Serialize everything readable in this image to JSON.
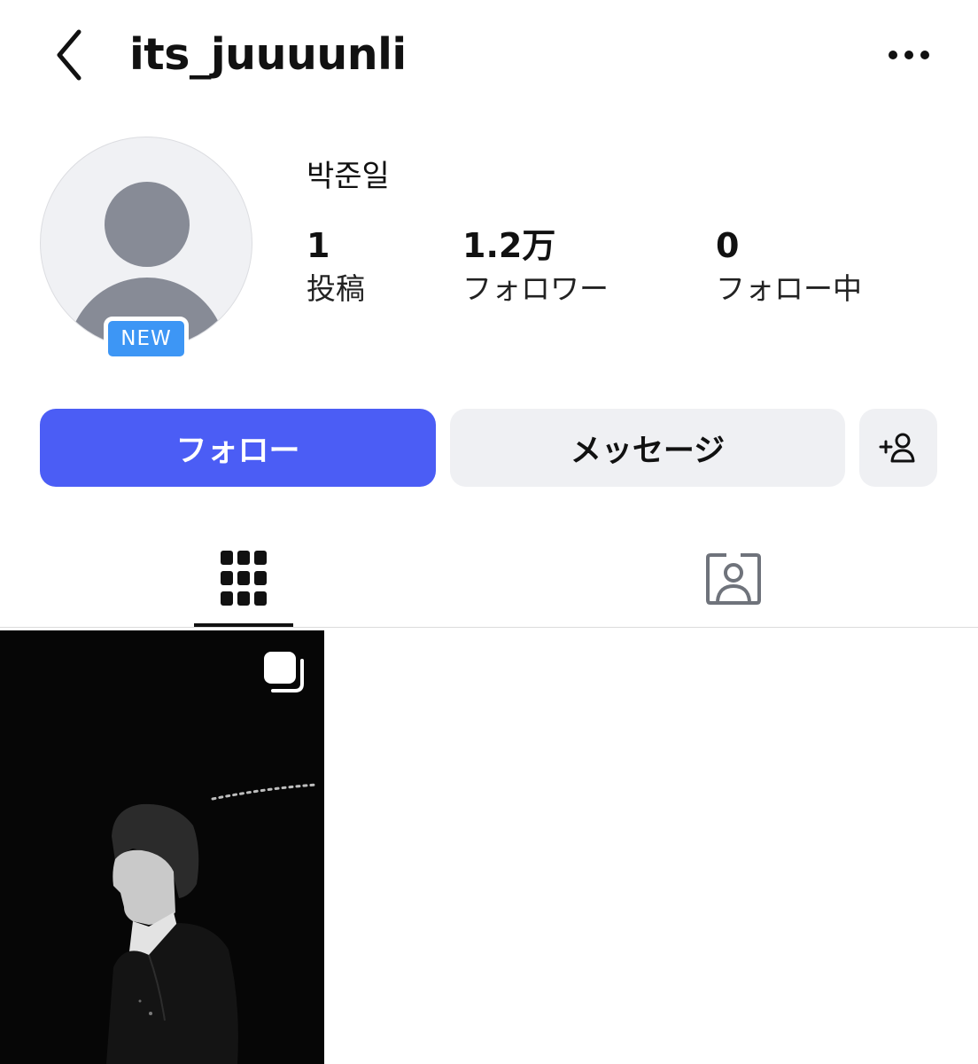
{
  "header": {
    "username": "its_juuuunli",
    "back_icon": "chevron-left-icon",
    "more_icon": "more-horizontal-icon"
  },
  "profile": {
    "display_name": "박준일",
    "badge": "NEW",
    "avatar_icon": "default-avatar-icon"
  },
  "stats": {
    "posts": {
      "value": "1",
      "label": "投稿"
    },
    "followers": {
      "value": "1.2万",
      "label": "フォロワー"
    },
    "following": {
      "value": "0",
      "label": "フォロー中"
    }
  },
  "actions": {
    "follow_label": "フォロー",
    "message_label": "メッセージ",
    "add_user_icon": "add-user-icon"
  },
  "tabs": [
    {
      "name": "posts-grid",
      "icon": "grid-icon",
      "active": true
    },
    {
      "name": "tagged",
      "icon": "tagged-person-icon",
      "active": false
    }
  ],
  "posts": [
    {
      "type": "carousel",
      "icon": "carousel-icon",
      "description": "black and white photo"
    }
  ],
  "colors": {
    "primary_button": "#4b5df5",
    "secondary_button": "#eff0f3",
    "badge": "#3d96f5",
    "avatar_placeholder": "#878b96"
  }
}
